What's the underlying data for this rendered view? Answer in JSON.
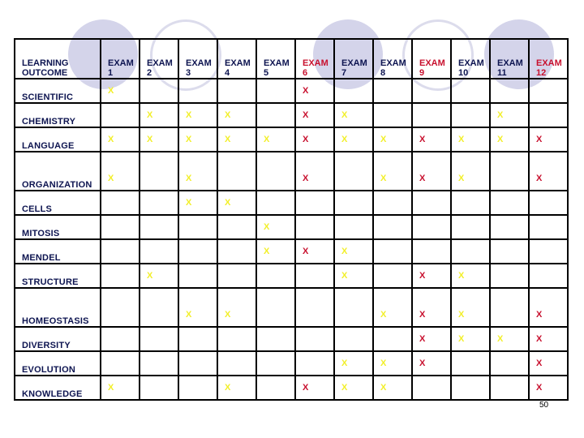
{
  "colors": {
    "yellow_mark": "#f2ef2a",
    "red_mark": "#c8102e",
    "navy_text": "#0d1450"
  },
  "header": {
    "label": "LEARNING OUTCOME",
    "label_line1": "LEARNING",
    "label_line2": "OUTCOME",
    "exams": [
      {
        "line1": "EXAM",
        "line2": "1",
        "color": "navy"
      },
      {
        "line1": "EXAM",
        "line2": "2",
        "color": "navy"
      },
      {
        "line1": "EXAM",
        "line2": "3",
        "color": "navy"
      },
      {
        "line1": "EXAM",
        "line2": "4",
        "color": "navy"
      },
      {
        "line1": "EXAM",
        "line2": "5",
        "color": "navy"
      },
      {
        "line1": "EXAM",
        "line2": "6",
        "color": "red"
      },
      {
        "line1": "EXAM",
        "line2": "7",
        "color": "navy"
      },
      {
        "line1": "EXAM",
        "line2": "8",
        "color": "navy"
      },
      {
        "line1": "EXAM",
        "line2": "9",
        "color": "red"
      },
      {
        "line1": "EXAM",
        "line2": "10",
        "color": "navy"
      },
      {
        "line1": "EXAM",
        "line2": "11",
        "color": "navy"
      },
      {
        "line1": "EXAM",
        "line2": "12",
        "color": "red"
      }
    ]
  },
  "mark_symbol": "X",
  "rows": [
    {
      "label": "SCIENTIFIC",
      "marks": [
        "Y",
        "",
        "",
        "",
        "",
        "R",
        "",
        "",
        "",
        "",
        "",
        ""
      ]
    },
    {
      "label": "CHEMISTRY",
      "marks": [
        "",
        "Y",
        "Y",
        "Y",
        "",
        "R",
        "Y",
        "",
        "",
        "",
        "Y",
        ""
      ]
    },
    {
      "label": "LANGUAGE",
      "marks": [
        "Y",
        "Y",
        "Y",
        "Y",
        "Y",
        "R",
        "Y",
        "Y",
        "R",
        "Y",
        "Y",
        "R"
      ]
    },
    {
      "label": "ORGANIZATION",
      "marks": [
        "Y",
        "",
        "Y",
        "",
        "",
        "R",
        "",
        "Y",
        "R",
        "Y",
        "",
        "R"
      ]
    },
    {
      "label": "CELLS",
      "marks": [
        "",
        "",
        "Y",
        "Y",
        "",
        "",
        "",
        "",
        "",
        "",
        "",
        ""
      ]
    },
    {
      "label": "MITOSIS",
      "marks": [
        "",
        "",
        "",
        "",
        "Y",
        "",
        "",
        "",
        "",
        "",
        "",
        ""
      ]
    },
    {
      "label": "MENDEL",
      "marks": [
        "",
        "",
        "",
        "",
        "Y",
        "R",
        "Y",
        "",
        "",
        "",
        "",
        ""
      ]
    },
    {
      "label": "STRUCTURE",
      "marks": [
        "",
        "Y",
        "",
        "",
        "",
        "",
        "Y",
        "",
        "R",
        "Y",
        "",
        ""
      ]
    },
    {
      "label": "HOMEOSTASIS",
      "marks": [
        "",
        "",
        "Y",
        "Y",
        "",
        "",
        "",
        "Y",
        "R",
        "Y",
        "",
        "R"
      ]
    },
    {
      "label": "DIVERSITY",
      "marks": [
        "",
        "",
        "",
        "",
        "",
        "",
        "",
        "",
        "R",
        "Y",
        "Y",
        "R"
      ]
    },
    {
      "label": "EVOLUTION",
      "marks": [
        "",
        "",
        "",
        "",
        "",
        "",
        "Y",
        "Y",
        "R",
        "",
        "",
        "R"
      ]
    },
    {
      "label": "KNOWLEDGE",
      "marks": [
        "Y",
        "",
        "",
        "Y",
        "",
        "R",
        "Y",
        "Y",
        "",
        "",
        "",
        "R"
      ]
    }
  ],
  "page_number": "50"
}
